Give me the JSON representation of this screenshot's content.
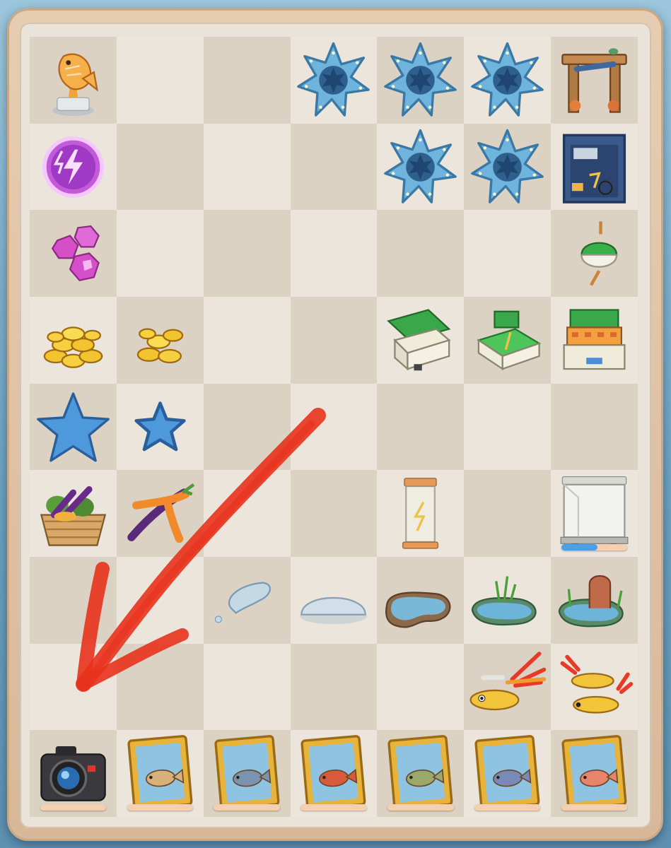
{
  "board": {
    "columns": 7,
    "rows": 9,
    "cells": [
      [
        "trophy-fish-icon",
        "",
        "",
        "starfish-icon",
        "starfish-icon",
        "starfish-icon",
        "fishing-gate-icon"
      ],
      [
        "energy-orb-icon",
        "",
        "",
        "",
        "starfish-icon",
        "starfish-icon",
        "storage-cabinet-icon"
      ],
      [
        "gems-icon",
        "",
        "",
        "",
        "",
        "",
        "fishing-bobber-icon"
      ],
      [
        "coin-pile-large-icon",
        "coin-pile-small-icon",
        "",
        "",
        "tackle-box-open-icon",
        "tackle-box-closed-icon",
        "tackle-box-stacked-icon"
      ],
      [
        "star-large-icon",
        "star-small-icon",
        "",
        "",
        "",
        "",
        ""
      ],
      [
        "vegetable-basket-icon",
        "carrots-icon",
        "",
        "",
        "display-case-small-icon",
        "",
        "display-case-large-icon"
      ],
      [
        "",
        "",
        "water-drop-icon",
        "water-puddle-icon",
        "small-pond-icon",
        "grass-pond-icon",
        "pond-with-gate-icon"
      ],
      [
        "",
        "",
        "",
        "",
        "",
        "fishing-lure-large-icon",
        "fishing-lures-pair-icon"
      ],
      [
        "camera-icon",
        "fish-frame-crab-icon",
        "fish-frame-shark-icon",
        "fish-frame-redfish-icon",
        "fish-frame-perch-icon",
        "fish-frame-stingray-icon",
        "fish-frame-snapper-icon"
      ]
    ],
    "progress": {
      "display-case-large": 0.55,
      "camera": 0,
      "frames": 0
    },
    "colors": {
      "accent_arrow": "#e8321c",
      "frame_gold": "#e8b33a",
      "progress_blue": "#4ea0e6"
    }
  }
}
